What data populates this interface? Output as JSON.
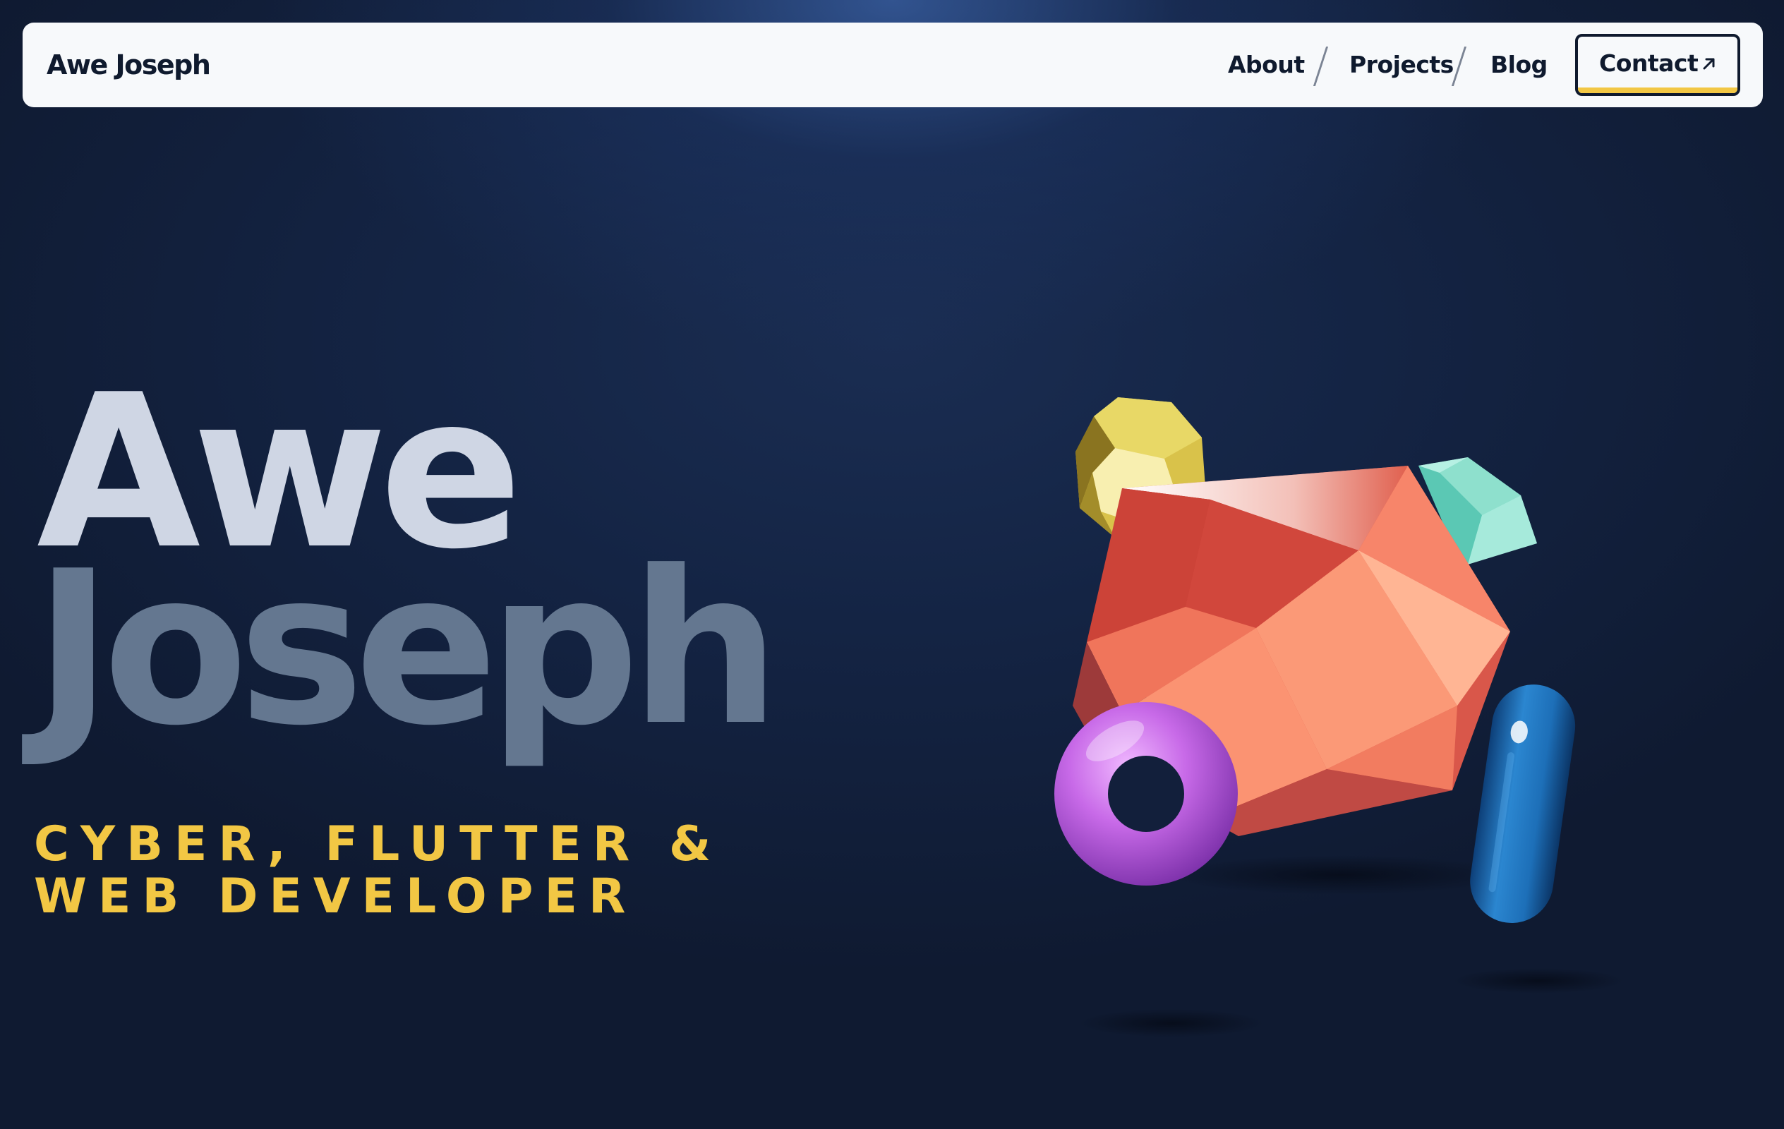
{
  "navbar": {
    "brand": "Awe Joseph",
    "links": [
      {
        "label": "About"
      },
      {
        "label": "Projects"
      },
      {
        "label": "Blog"
      }
    ],
    "contact": {
      "label": "Contact",
      "icon": "arrow-up-right-icon"
    }
  },
  "hero": {
    "first_name": "Awe",
    "last_name": "Joseph",
    "subtitle": "CYBER, FLUTTER & WEB DEVELOPER"
  },
  "colors": {
    "background": "#0f1a30",
    "navbar": "#f7f9fb",
    "accent": "#f2c744",
    "first_name": "#cfd6e4",
    "last_name": "#647790"
  }
}
